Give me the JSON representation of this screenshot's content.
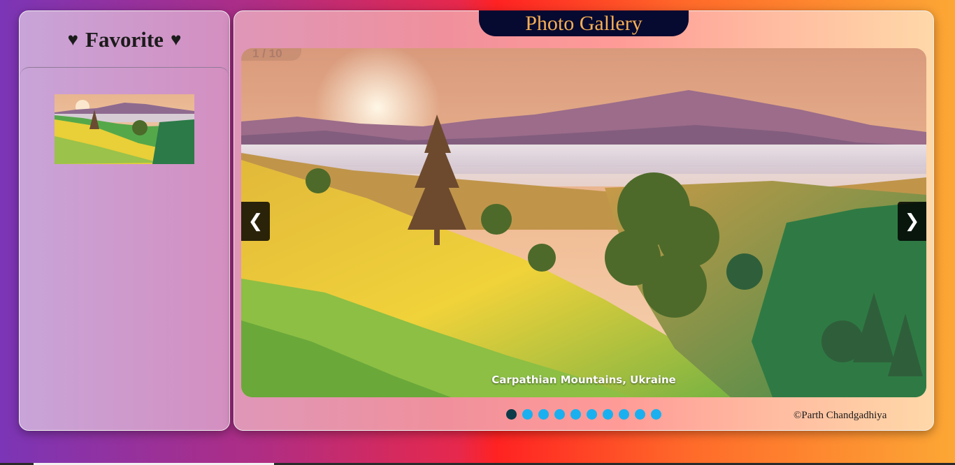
{
  "sidebar": {
    "title": "Favorite",
    "heart_icon": "♥",
    "favorites": [
      {
        "caption": "Carpathian Mountains, Ukraine"
      }
    ]
  },
  "gallery": {
    "title": "Photo Gallery",
    "counter": "1 / 10",
    "caption": "Carpathian Mountains, Ukraine",
    "prev_label": "❮",
    "next_label": "❯",
    "dots_total": 10,
    "active_dot": 1,
    "credit": "©Parth Chandgadhiya"
  },
  "colors": {
    "title_bar_bg": "#070a30",
    "title_text": "#f6ae55",
    "dot": "#1ab0ef",
    "dot_active": "#0c3b4a"
  }
}
